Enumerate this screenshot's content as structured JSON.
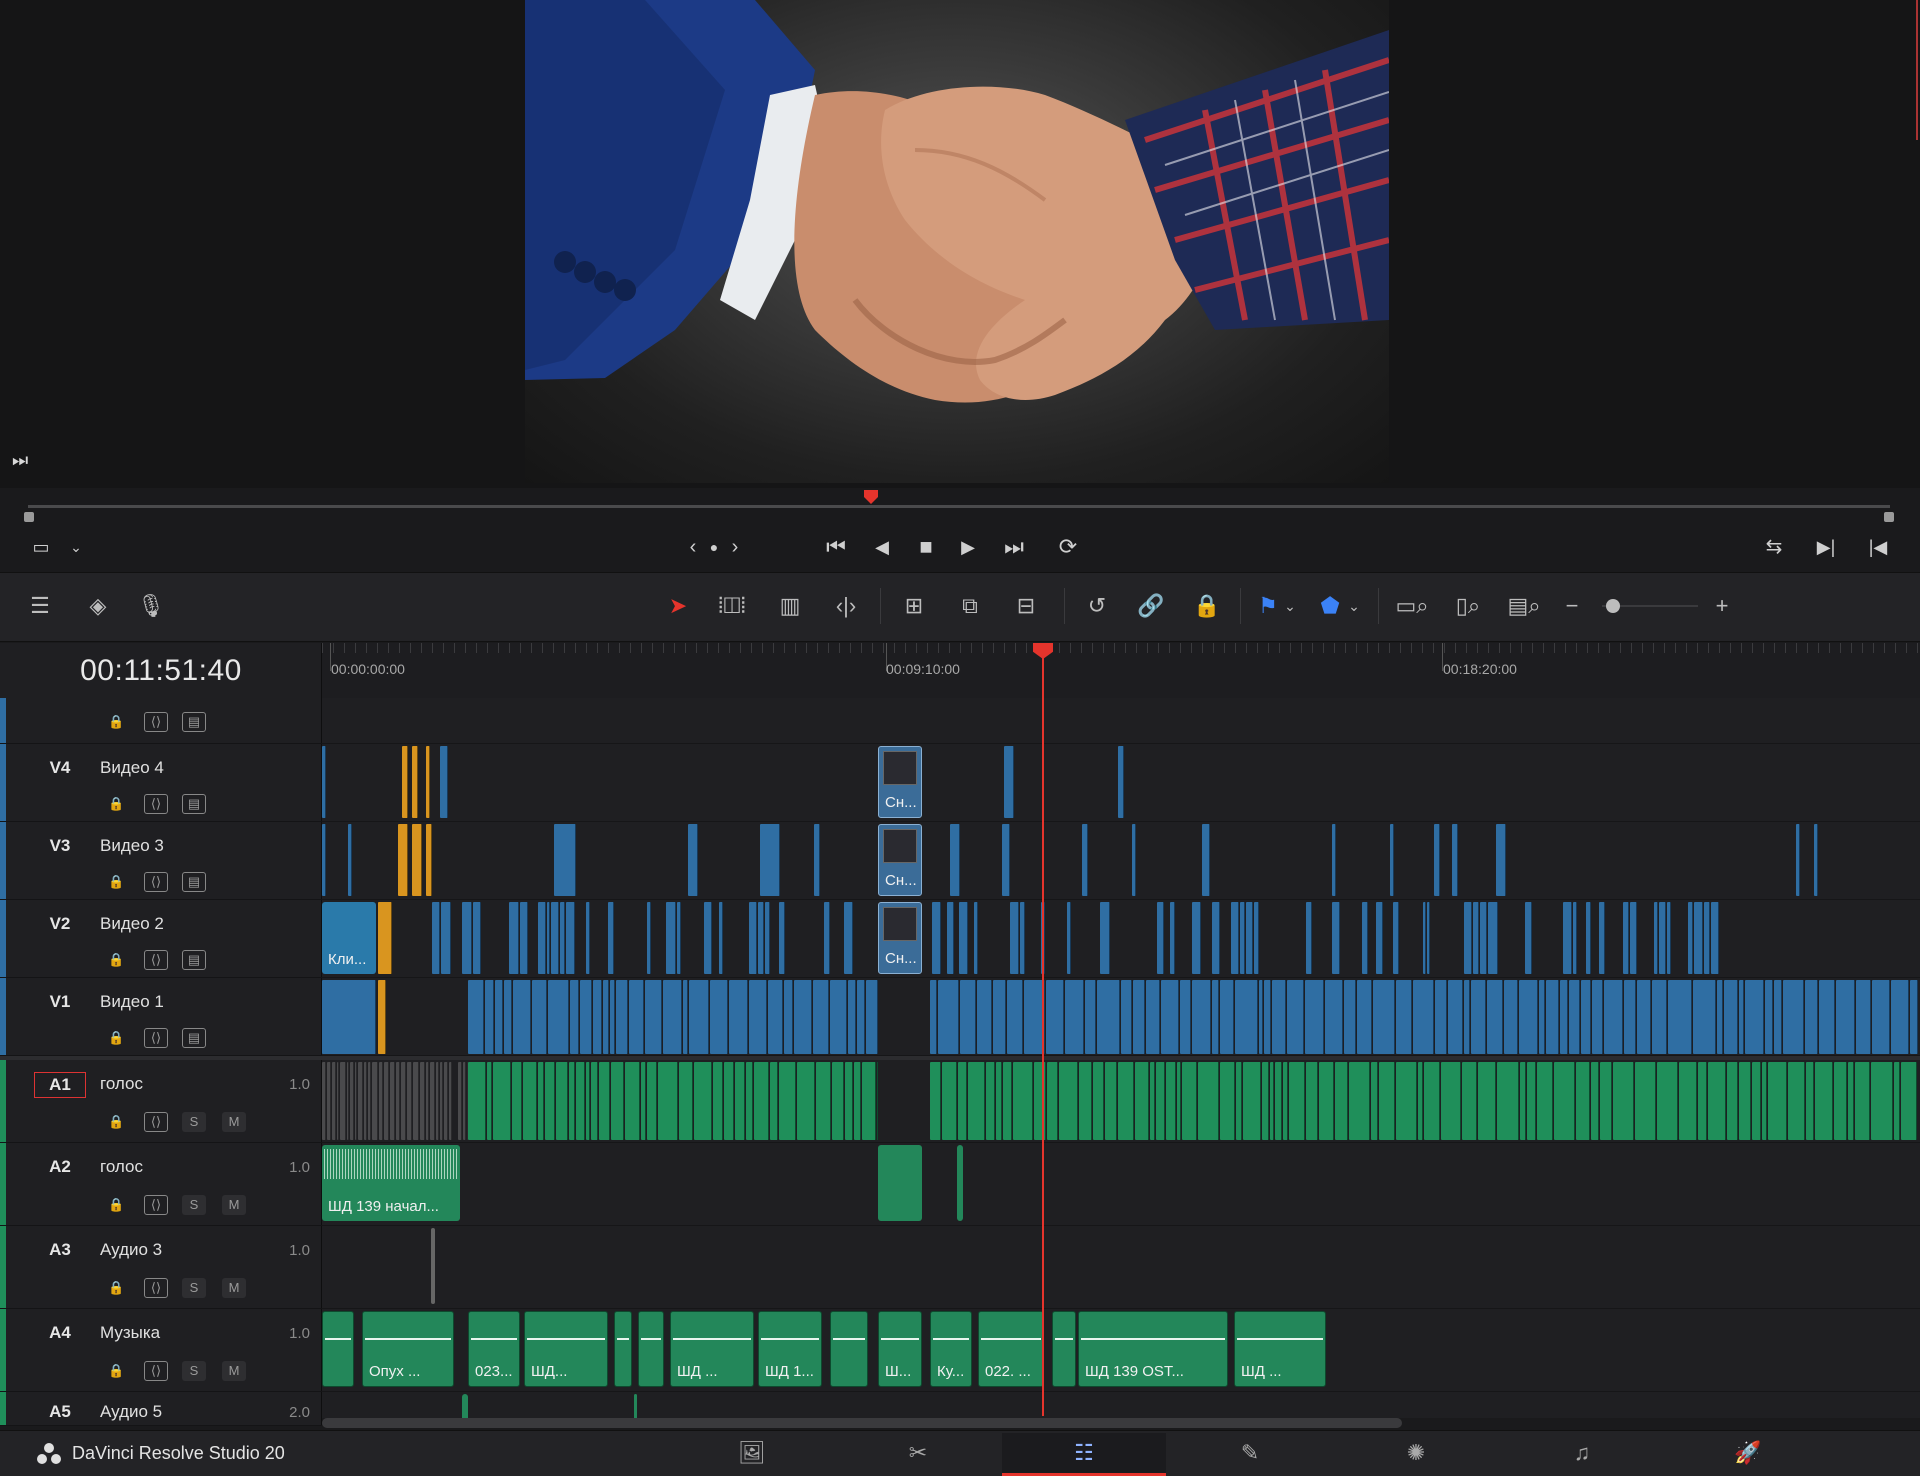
{
  "app": {
    "name": "DaVinci Resolve Studio 20"
  },
  "viewer": {
    "image_alt": "Рукопожатие",
    "scrubber_position": 0.372
  },
  "transport": {
    "jog_prev": "‹",
    "jog_next": "›",
    "buttons": [
      "first-frame",
      "play-reverse",
      "stop",
      "play",
      "last-frame",
      "loop"
    ]
  },
  "timeline": {
    "timecode": "00:11:51:40",
    "ruler_labels": [
      "00:00:00:00",
      "00:09:10:00",
      "00:18:20:00"
    ],
    "tracks": {
      "v5": {
        "id": "",
        "name": ""
      },
      "v4": {
        "id": "V4",
        "name": "Видео 4"
      },
      "v3": {
        "id": "V3",
        "name": "Видео 3"
      },
      "v2": {
        "id": "V2",
        "name": "Видео 2"
      },
      "v1": {
        "id": "V1",
        "name": "Видео 1"
      },
      "a1": {
        "id": "A1",
        "name": "голос",
        "vol": "1.0"
      },
      "a2": {
        "id": "A2",
        "name": "голос",
        "vol": "1.0"
      },
      "a3": {
        "id": "A3",
        "name": "Аудио 3",
        "vol": "1.0"
      },
      "a4": {
        "id": "A4",
        "name": "Музыка",
        "vol": "1.0"
      },
      "a5": {
        "id": "A5",
        "name": "Аудио 5",
        "vol": "2.0"
      }
    },
    "solo_label": "S",
    "mute_label": "M",
    "clip_labels": {
      "v4_clip": "Сн...",
      "v3_clip": "Сн...",
      "v2_first": "Кли...",
      "v2_clip": "Сн...",
      "a2_clip": "ШД 139 начал...",
      "a4": [
        "Опух ...",
        "023...",
        "ШД...",
        "ШД ...",
        "ШД 1...",
        "Ш...",
        "Ку...",
        "022. ...",
        "ШД 139 OST...",
        "ШД ..."
      ]
    }
  },
  "colors": {
    "video_clip": "#2f6ea3",
    "audio_clip": "#1f8f5a",
    "orange_clip": "#d9951f",
    "playhead": "#e5342c",
    "music_clip": "#23875a"
  }
}
